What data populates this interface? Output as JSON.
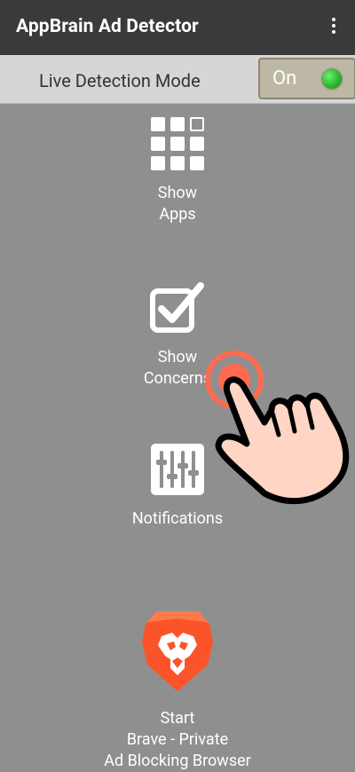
{
  "appbar": {
    "title": "AppBrain Ad Detector",
    "menu_icon": "more-vert-icon"
  },
  "live_mode": {
    "label": "Live Detection Mode",
    "toggle_text": "On",
    "status_color": "#2eb82e"
  },
  "items": [
    {
      "icon": "grid-apps-icon",
      "line1": "Show",
      "line2": "Apps"
    },
    {
      "icon": "checkbox-icon",
      "line1": "Show",
      "line2": "Concerns"
    },
    {
      "icon": "equalizer-icon",
      "line1": "Notifications"
    },
    {
      "icon": "brave-lion-icon",
      "line1": "Start",
      "line2": "Brave - Private",
      "line3": "Ad Blocking Browser"
    }
  ],
  "overlay": {
    "icon": "tap-hand-icon"
  }
}
